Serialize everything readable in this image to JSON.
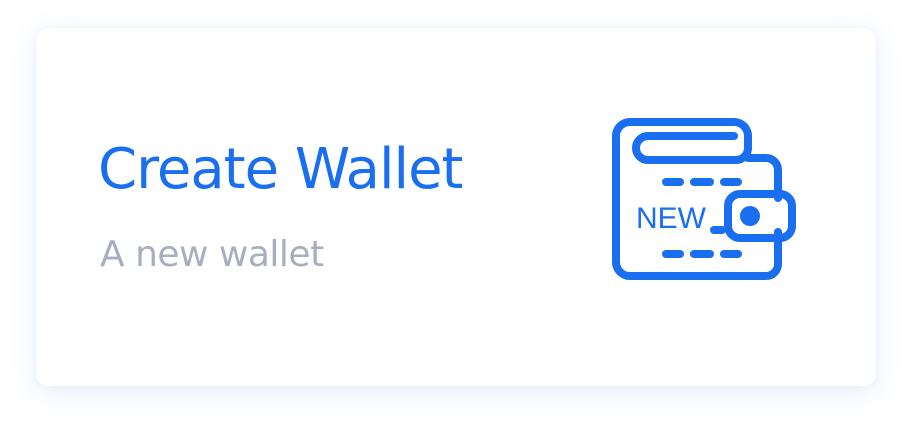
{
  "card": {
    "title": "Create Wallet",
    "subtitle": "A new wallet",
    "icon": {
      "name": "wallet-new-icon",
      "badge_text": "NEW"
    }
  },
  "colors": {
    "accent": "#1a6ef0",
    "subtitle": "#a7afbf",
    "card_background": "#ffffff"
  }
}
